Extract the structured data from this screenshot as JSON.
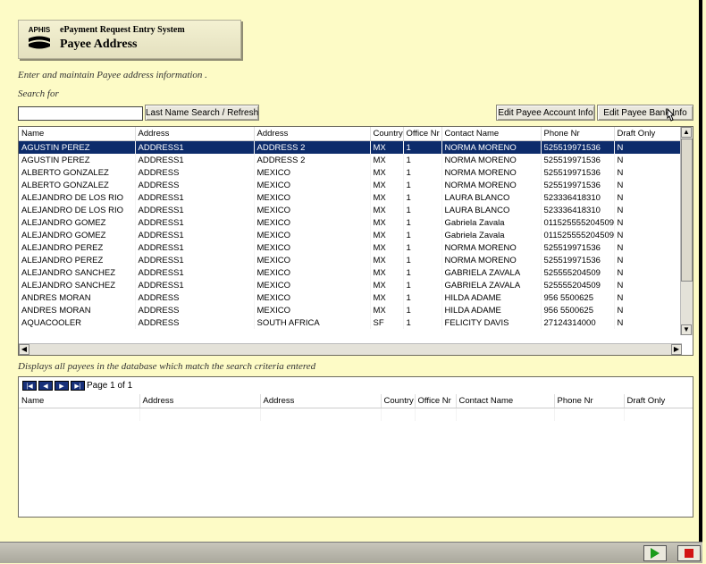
{
  "header": {
    "logo_text": "APHIS",
    "system_name": "ePayment Request Entry System",
    "page_title": "Payee Address"
  },
  "intro_text": "Enter and maintain Payee address information .",
  "search": {
    "label": "Search for",
    "value": "",
    "search_button": "Last Name Search / Refresh"
  },
  "actions": {
    "edit_account": "Edit Payee Account Info",
    "edit_bank": "Edit Payee Bank Info"
  },
  "results": {
    "columns": [
      "Name",
      "Address",
      "Address",
      "Country",
      "Office Nr",
      "Contact Name",
      "Phone Nr",
      "Draft Only"
    ],
    "rows": [
      [
        "AGUSTIN PEREZ",
        "ADDRESS1",
        "ADDRESS 2",
        "MX",
        "1",
        "NORMA MORENO",
        "525519971536",
        "N"
      ],
      [
        "AGUSTIN PEREZ",
        "ADDRESS1",
        "ADDRESS 2",
        "MX",
        "1",
        "NORMA MORENO",
        "525519971536",
        "N"
      ],
      [
        "ALBERTO GONZALEZ",
        "ADDRESS",
        "MEXICO",
        "MX",
        "1",
        "NORMA MORENO",
        "525519971536",
        "N"
      ],
      [
        "ALBERTO GONZALEZ",
        "ADDRESS",
        "MEXICO",
        "MX",
        "1",
        "NORMA MORENO",
        "525519971536",
        "N"
      ],
      [
        "ALEJANDRO DE LOS RIO",
        "ADDRESS1",
        "MEXICO",
        "MX",
        "1",
        "LAURA BLANCO",
        "523336418310",
        "N"
      ],
      [
        "ALEJANDRO DE LOS RIO",
        "ADDRESS1",
        "MEXICO",
        "MX",
        "1",
        "LAURA BLANCO",
        "523336418310",
        "N"
      ],
      [
        "ALEJANDRO GOMEZ",
        "ADDRESS1",
        "MEXICO",
        "MX",
        "1",
        "Gabriela Zavala",
        "011525555204509",
        "N"
      ],
      [
        "ALEJANDRO GOMEZ",
        "ADDRESS1",
        "MEXICO",
        "MX",
        "1",
        "Gabriela Zavala",
        "011525555204509",
        "N"
      ],
      [
        "ALEJANDRO PEREZ",
        "ADDRESS1",
        "MEXICO",
        "MX",
        "1",
        "NORMA MORENO",
        "525519971536",
        "N"
      ],
      [
        "ALEJANDRO PEREZ",
        "ADDRESS1",
        "MEXICO",
        "MX",
        "1",
        "NORMA MORENO",
        "525519971536",
        "N"
      ],
      [
        "ALEJANDRO SANCHEZ",
        "ADDRESS1",
        "MEXICO",
        "MX",
        "1",
        "GABRIELA ZAVALA",
        "525555204509",
        "N"
      ],
      [
        "ALEJANDRO SANCHEZ",
        "ADDRESS1",
        "MEXICO",
        "MX",
        "1",
        "GABRIELA ZAVALA",
        "525555204509",
        "N"
      ],
      [
        "ANDRES MORAN",
        "ADDRESS",
        "MEXICO",
        "MX",
        "1",
        "HILDA ADAME",
        "956 5500625",
        "N"
      ],
      [
        "ANDRES MORAN",
        "ADDRESS",
        "MEXICO",
        "MX",
        "1",
        "HILDA ADAME",
        "956 5500625",
        "N"
      ],
      [
        "AQUACOOLER",
        "ADDRESS",
        "SOUTH AFRICA",
        "SF",
        "1",
        "FELICITY DAVIS",
        "27124314000",
        "N"
      ]
    ]
  },
  "description": "Displays all payees in the database which match the search criteria entered",
  "detail": {
    "page_label": "Page 1 of 1",
    "columns": [
      "Name",
      "Address",
      "Address",
      "Country",
      "Office Nr",
      "Contact Name",
      "Phone Nr",
      "Draft Only"
    ]
  }
}
